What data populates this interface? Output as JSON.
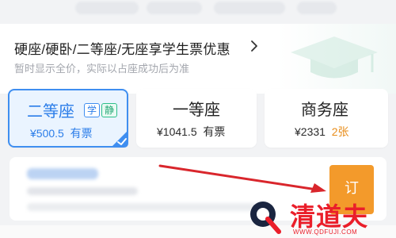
{
  "promo": {
    "title": "硬座/硬卧/二等座/无座享学生票优惠",
    "subtitle": "暂时显示全价，实际以占座成功后为准"
  },
  "seats": [
    {
      "name": "二等座",
      "price": "¥500.5",
      "availability": "有票",
      "tags": [
        "学",
        "静"
      ],
      "selected": true
    },
    {
      "name": "一等座",
      "price": "¥1041.5",
      "availability": "有票",
      "selected": false
    },
    {
      "name": "商务座",
      "price": "¥2331",
      "availability": "2张",
      "selected": false
    }
  ],
  "book_button": {
    "label": "订"
  },
  "watermark": {
    "brand": "清道夫",
    "url": "WWW.QDFUJI.COM"
  },
  "colors": {
    "selected_blue": "#2b7de9",
    "green_tag": "#23a774",
    "orange": "#f39a2b",
    "watermark_red": "#ea1e2a",
    "annotation_red": "#d9262c"
  }
}
